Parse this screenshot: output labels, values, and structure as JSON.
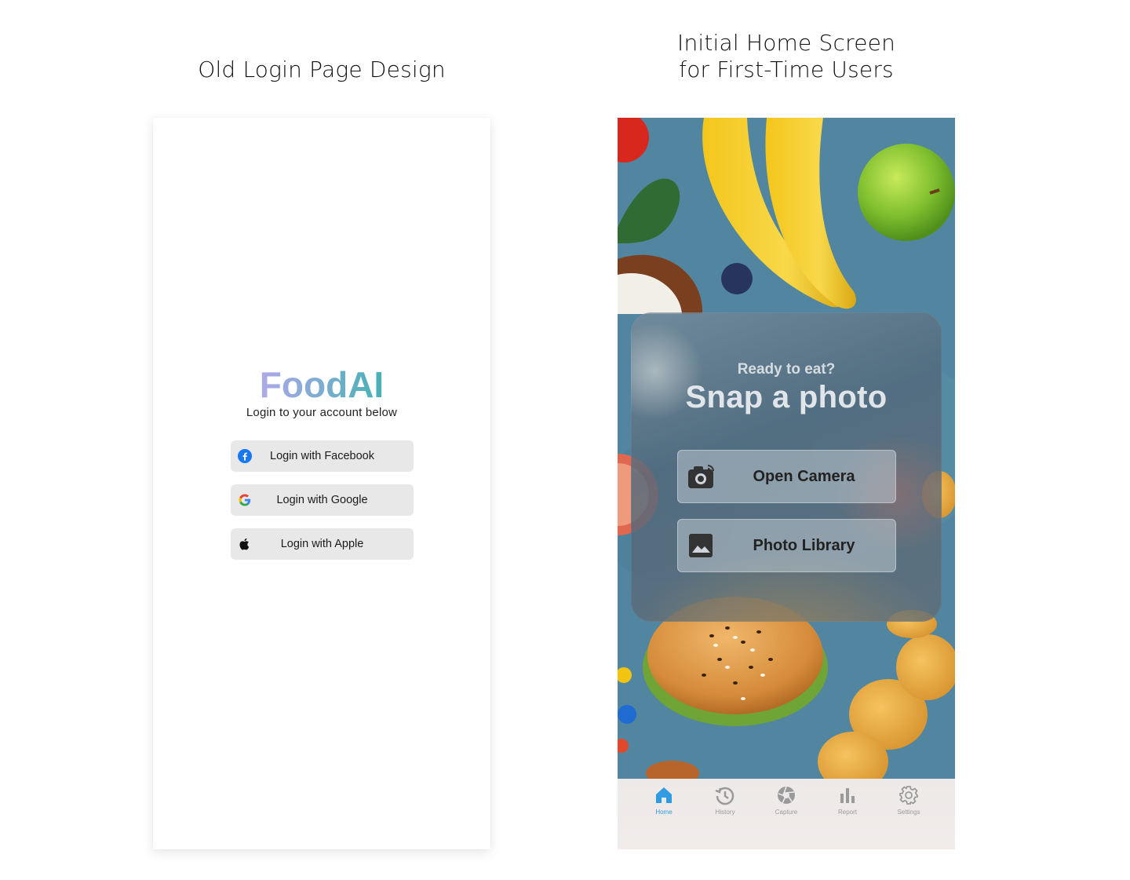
{
  "headings": {
    "left": "Old Login Page Design",
    "right_line1": "Initial Home Screen",
    "right_line2": "for First-Time Users"
  },
  "login": {
    "brand": "FoodAI",
    "subtitle": "Login to your account below",
    "buttons": [
      {
        "label": "Login with Facebook",
        "icon": "facebook-icon"
      },
      {
        "label": "Login with Google",
        "icon": "google-icon"
      },
      {
        "label": "Login with Apple",
        "icon": "apple-icon"
      }
    ],
    "brand_gradient": [
      "#d5b3f6",
      "#1aa98f"
    ]
  },
  "home": {
    "kicker": "Ready to eat?",
    "title": "Snap a photo",
    "actions": [
      {
        "label": "Open Camera",
        "icon": "camera-icon"
      },
      {
        "label": "Photo Library",
        "icon": "image-icon"
      }
    ],
    "tabs": [
      {
        "label": "Home",
        "icon": "home-icon",
        "active": true
      },
      {
        "label": "History",
        "icon": "history-icon",
        "active": false
      },
      {
        "label": "Capture",
        "icon": "aperture-icon",
        "active": false
      },
      {
        "label": "Report",
        "icon": "bar-chart-icon",
        "active": false
      },
      {
        "label": "Settings",
        "icon": "gear-icon",
        "active": false
      }
    ],
    "accent_color": "#2f9be3"
  }
}
